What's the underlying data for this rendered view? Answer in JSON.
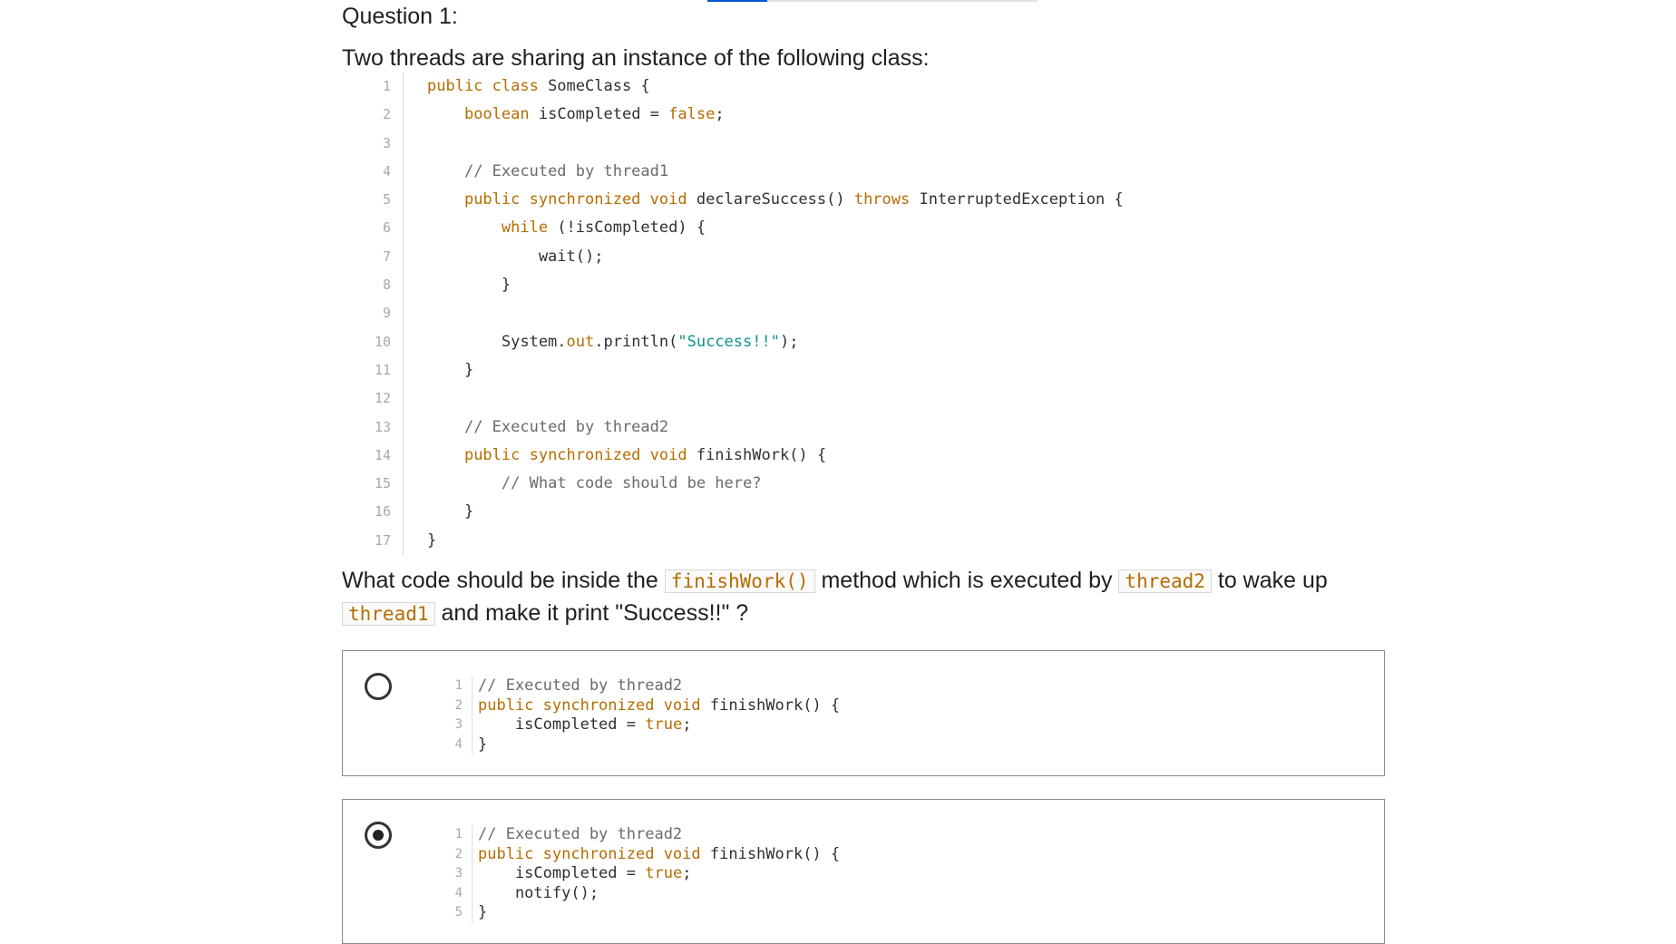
{
  "quiz": {
    "progress": 0.18,
    "question_label": "Question 1:",
    "intro": "Two threads are sharing an instance of the following class:",
    "code": [
      [
        {
          "t": "public class",
          "c": "kw"
        },
        {
          "t": " SomeClass {"
        }
      ],
      [
        {
          "t": "    "
        },
        {
          "t": "boolean",
          "c": "kw"
        },
        {
          "t": " isCompleted = "
        },
        {
          "t": "false",
          "c": "kw"
        },
        {
          "t": ";"
        }
      ],
      [],
      [
        {
          "t": "    "
        },
        {
          "t": "// Executed by thread1",
          "c": "cmt"
        }
      ],
      [
        {
          "t": "    "
        },
        {
          "t": "public synchronized void",
          "c": "kw"
        },
        {
          "t": " declareSuccess() "
        },
        {
          "t": "throws",
          "c": "kw"
        },
        {
          "t": " InterruptedException {"
        }
      ],
      [
        {
          "t": "        "
        },
        {
          "t": "while",
          "c": "kw"
        },
        {
          "t": " (!isCompleted) {"
        }
      ],
      [
        {
          "t": "            wait();"
        }
      ],
      [
        {
          "t": "        }"
        }
      ],
      [],
      [
        {
          "t": "        System."
        },
        {
          "t": "out",
          "c": "kw"
        },
        {
          "t": ".println("
        },
        {
          "t": "\"Success!!\"",
          "c": "str"
        },
        {
          "t": ");"
        }
      ],
      [
        {
          "t": "    }"
        }
      ],
      [],
      [
        {
          "t": "    "
        },
        {
          "t": "// Executed by thread2",
          "c": "cmt"
        }
      ],
      [
        {
          "t": "    "
        },
        {
          "t": "public synchronized void",
          "c": "kw"
        },
        {
          "t": " finishWork() {"
        }
      ],
      [
        {
          "t": "        "
        },
        {
          "t": "// What code should be here?",
          "c": "cmt"
        }
      ],
      [
        {
          "t": "    }"
        }
      ],
      [
        {
          "t": "}"
        }
      ]
    ],
    "prompt": {
      "before": "What code should be inside the ",
      "code1": "finishWork()",
      "mid1": " method which is executed by ",
      "code2": "thread2",
      "mid2": " to wake up ",
      "code3": "thread1",
      "after": " and make it print \"Success!!\" ?"
    },
    "options": [
      {
        "selected": false,
        "code": [
          [
            {
              "t": "// Executed by thread2",
              "c": "cmt"
            }
          ],
          [
            {
              "t": "public synchronized void",
              "c": "kw"
            },
            {
              "t": " finishWork() {"
            }
          ],
          [
            {
              "t": "    isCompleted = "
            },
            {
              "t": "true",
              "c": "kw"
            },
            {
              "t": ";"
            }
          ],
          [
            {
              "t": "}"
            }
          ]
        ]
      },
      {
        "selected": true,
        "code": [
          [
            {
              "t": "// Executed by thread2",
              "c": "cmt"
            }
          ],
          [
            {
              "t": "public synchronized void",
              "c": "kw"
            },
            {
              "t": " finishWork() {"
            }
          ],
          [
            {
              "t": "    isCompleted = "
            },
            {
              "t": "true",
              "c": "kw"
            },
            {
              "t": ";"
            }
          ],
          [
            {
              "t": "    notify();"
            }
          ],
          [
            {
              "t": "}"
            }
          ]
        ]
      }
    ]
  }
}
